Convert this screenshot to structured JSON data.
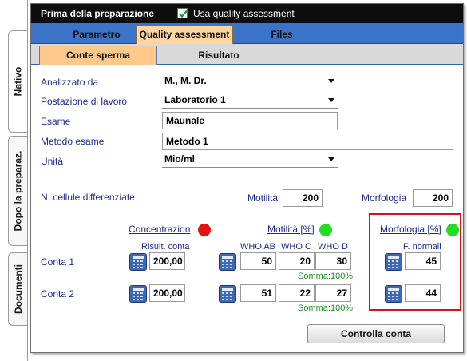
{
  "side_tabs": [
    "Nativo",
    "Dopo la preparaz.",
    "Documenti"
  ],
  "window": {
    "title": "Prima della preparazione",
    "checkbox_label": "Usa quality assessment",
    "checkbox_checked": true
  },
  "tabs_main": [
    "Parametro",
    "Quality assessment",
    "Files"
  ],
  "tabs_sub": [
    "Conte sperma",
    "Risultato"
  ],
  "form": {
    "analizzato_label": "Analizzato da",
    "analizzato_value": "M., M. Dr.",
    "postazione_label": "Postazione di lavoro",
    "postazione_value": "Laboratorio 1",
    "esame_label": "Esame",
    "esame_value": "Maunale",
    "metodo_label": "Metodo esame",
    "metodo_value": "Metodo 1",
    "unita_label": "Unità",
    "unita_value": "Mio/ml"
  },
  "cells": {
    "label": "N. cellule differenziate",
    "motilita_label": "Motilità",
    "motilita_value": "200",
    "morfologia_label": "Morfologia",
    "morfologia_value": "200"
  },
  "sections": {
    "concentrazione": "Concentrazion",
    "motilita": "Motilità [%]",
    "morfologia": "Morfologia [%]",
    "status_colors": {
      "concentrazione": "#e81010",
      "motilita": "#22dd22",
      "morfologia": "#22dd22"
    }
  },
  "headers": {
    "risult_conta": "Risult. conta",
    "who_ab": "WHO AB",
    "who_c": "WHO C",
    "who_d": "WHO D",
    "f_normali": "F. normali"
  },
  "rows": [
    {
      "label": "Conta 1",
      "conc": "200,00",
      "ab": "50",
      "c": "20",
      "d": "30",
      "somma": "Somma:100%",
      "fnorm": "45"
    },
    {
      "label": "Conta 2",
      "conc": "200,00",
      "ab": "51",
      "c": "22",
      "d": "27",
      "somma": "Somma:100%",
      "fnorm": "44"
    }
  ],
  "button_label": "Controlla conta"
}
